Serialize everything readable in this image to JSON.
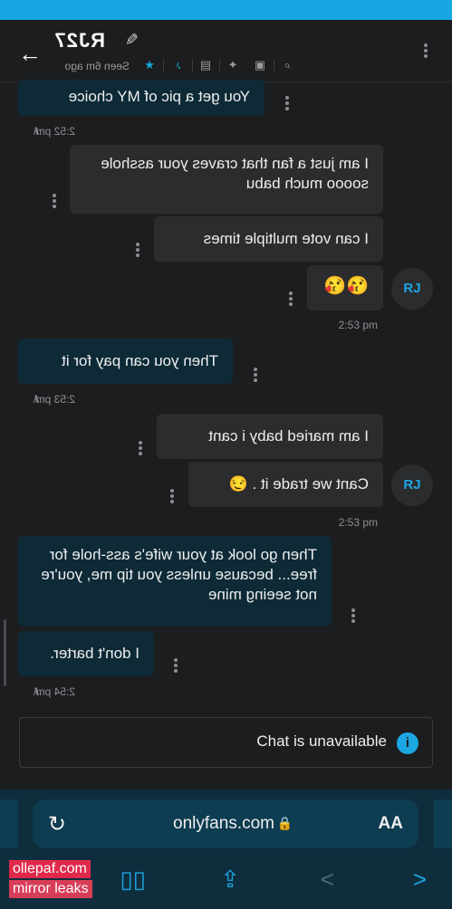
{
  "header": {
    "name": "RJ27",
    "seen": "Seen 6m ago"
  },
  "messages": [
    {
      "text": "You get a pic of MY choice"
    },
    {
      "text": "I am just a fan that craves your asshole soooo much babu"
    },
    {
      "text": "I can vote multiple times"
    },
    {
      "text": "😘😘"
    },
    {
      "text": "Then you can pay for it"
    },
    {
      "text": "I am maried baby i cant"
    },
    {
      "text": "Cant we trade it . 😏"
    },
    {
      "text": "Then go look at your wife's ass-hole for free... because unless you tip me, you're not seeing mine"
    },
    {
      "text": "I don't barter."
    }
  ],
  "times": [
    "2:52 pm",
    "2:53 pm",
    "2:53 pm",
    "2:53 pm",
    "2:54 pm"
  ],
  "avatar_initials": "RJ",
  "input": {
    "status": "Chat is unavailable"
  },
  "browser": {
    "url": "onlyfans.com",
    "text_size": "AA"
  },
  "watermark": {
    "line1": "ollepaf.com",
    "line2": "mirror leaks"
  },
  "colors": {
    "accent": "#1ca6e2",
    "incoming_bubble": "#0d2a36",
    "outgoing_bubble": "#2b2c2e"
  }
}
